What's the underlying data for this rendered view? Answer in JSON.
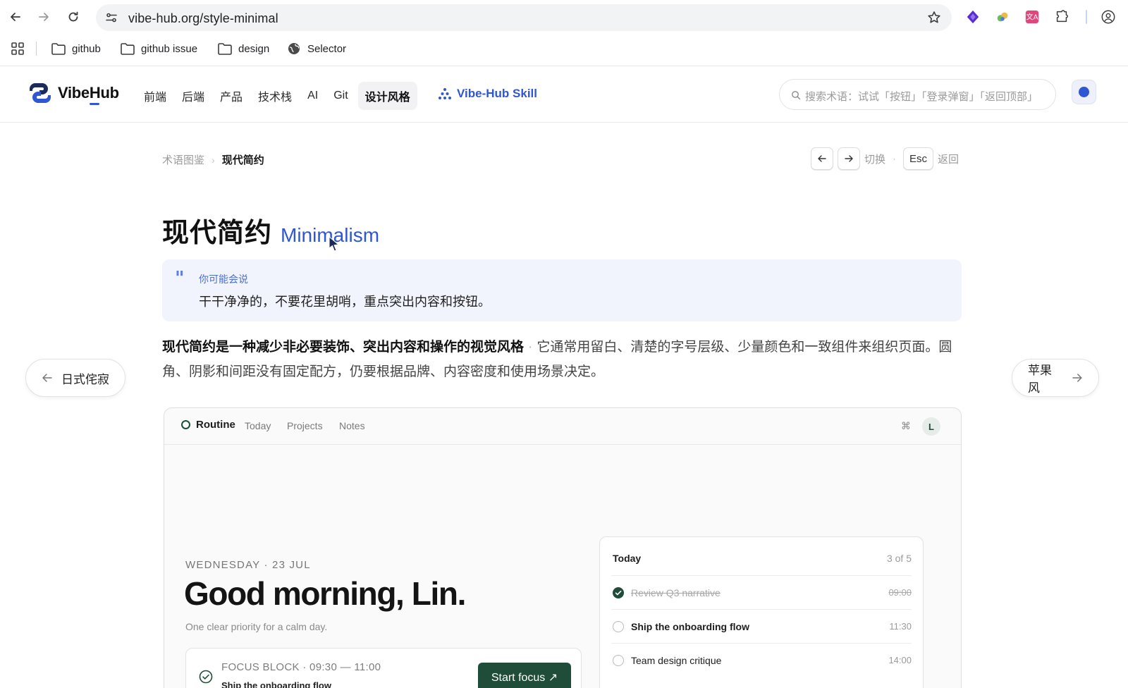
{
  "browser": {
    "url": "vibe-hub.org/style-minimal",
    "bookmarks": [
      {
        "label": "github",
        "icon": "folder-icon"
      },
      {
        "label": "github issue",
        "icon": "folder-icon"
      },
      {
        "label": "design",
        "icon": "folder-icon"
      },
      {
        "label": "Selector",
        "icon": "globe-icon"
      }
    ]
  },
  "header": {
    "logo": "VibeHub",
    "nav": [
      "前端",
      "后端",
      "产品",
      "技术栈",
      "AI",
      "Git",
      "设计风格"
    ],
    "active_nav": "设计风格",
    "skill_label": "Vibe-Hub Skill",
    "search_placeholder": "搜索术语：试试「按钮」「登录弹窗」「返回顶部」",
    "accent": "#2f56d3"
  },
  "breadcrumb": {
    "parent": "术语图鉴",
    "current": "现代简约"
  },
  "shortcuts": {
    "switch_label": "切换",
    "esc_key": "Esc",
    "back_label": "返回"
  },
  "page": {
    "title_zh": "现代简约",
    "title_en": "Minimalism",
    "quote_label": "你可能会说",
    "quote_text": "干干净净的，不要花里胡哨，重点突出内容和按钮。",
    "lead_bold": "现代简约是一种减少非必要装饰、突出内容和操作的视觉风格",
    "lead_rest": "它通常用留白、清楚的字号层级、少量颜色和一致组件来组织页面。圆角、阴影和间距没有固定配方，仍要根据品牌、内容密度和使用场景决定。",
    "prev_label": "日式侘寂",
    "next_label": "苹果风"
  },
  "preview": {
    "brand": "Routine",
    "links": [
      "Today",
      "Projects",
      "Notes"
    ],
    "cmd": "⌘",
    "avatar": "L",
    "date": "WEDNESDAY · 23 JUL",
    "greeting": "Good morning, Lin.",
    "subtitle": "One clear priority for a calm day.",
    "focus_meta": "FOCUS BLOCK · 09:30 — 11:00",
    "focus_title": "Ship the onboarding flow",
    "start_label": "Start focus ↗",
    "today_title": "Today",
    "today_count": "3 of 5",
    "tasks": [
      {
        "label": "Review Q3 narrative",
        "time": "09:00",
        "done": true
      },
      {
        "label": "Ship the onboarding flow",
        "time": "11:30",
        "done": false
      },
      {
        "label": "Team design critique",
        "time": "14:00",
        "done": false
      }
    ],
    "accent": "#1f4d3a"
  }
}
